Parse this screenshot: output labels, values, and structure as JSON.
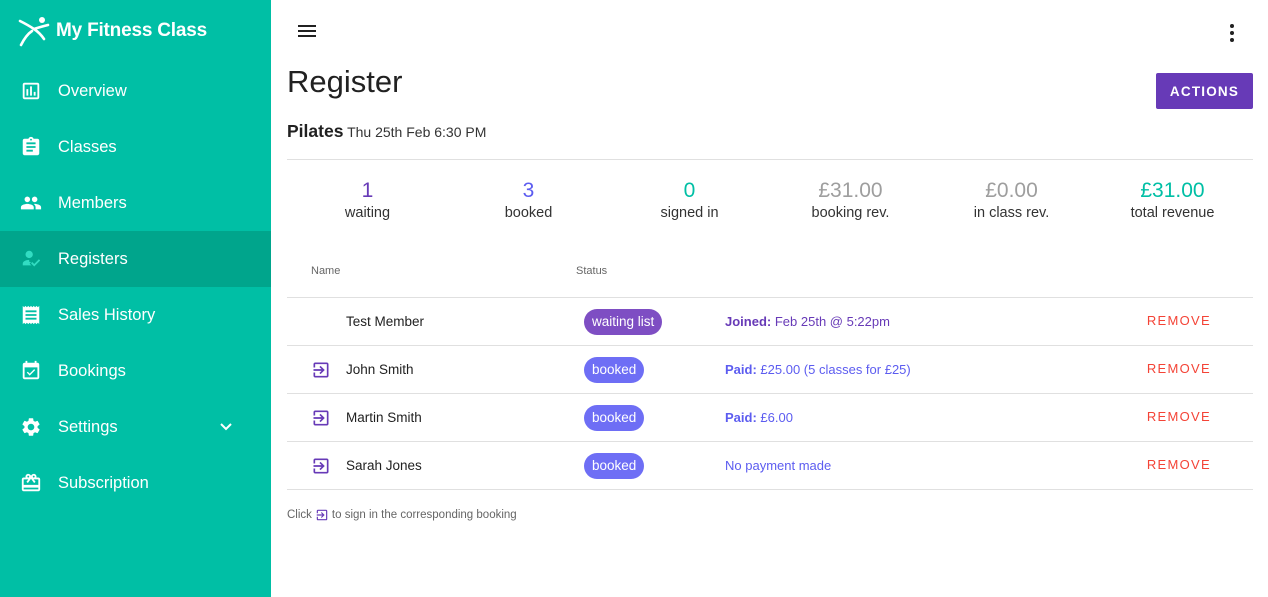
{
  "colors": {
    "sidebar_bg": "#00bfa5",
    "sidebar_active_bg": "#00a58c",
    "primary": "#673ab7",
    "booked": "#6e6ef5",
    "waiting": "#7e4ec3",
    "teal": "#00bfa5",
    "muted": "#9e9e9e",
    "danger": "#f44336"
  },
  "brand": {
    "name": "My Fitness Class",
    "logo_icon": "runner-logo-icon"
  },
  "sidebar": {
    "items": [
      {
        "label": "Overview",
        "icon": "bar-chart-icon",
        "active": false
      },
      {
        "label": "Classes",
        "icon": "clipboard-icon",
        "active": false
      },
      {
        "label": "Members",
        "icon": "people-icon",
        "active": false
      },
      {
        "label": "Registers",
        "icon": "person-check-icon",
        "active": true
      },
      {
        "label": "Sales History",
        "icon": "receipt-icon",
        "active": false
      },
      {
        "label": "Bookings",
        "icon": "calendar-check-icon",
        "active": false
      },
      {
        "label": "Settings",
        "icon": "gear-icon",
        "active": false,
        "expandable": true
      },
      {
        "label": "Subscription",
        "icon": "gift-card-icon",
        "active": false
      }
    ]
  },
  "header": {
    "menu_icon": "hamburger-menu-icon",
    "more_icon": "more-vertical-icon"
  },
  "page": {
    "title": "Register",
    "actions_label": "ACTIONS",
    "class_name": "Pilates",
    "class_when": "Thu 25th Feb 6:30 PM"
  },
  "stats": [
    {
      "value": "1",
      "label": "waiting",
      "color": "#673ab7"
    },
    {
      "value": "3",
      "label": "booked",
      "color": "#5c5cf0"
    },
    {
      "value": "0",
      "label": "signed in",
      "color": "#00bfa5"
    },
    {
      "value": "£31.00",
      "label": "booking rev.",
      "color": "#9e9e9e"
    },
    {
      "value": "£0.00",
      "label": "in class rev.",
      "color": "#9e9e9e"
    },
    {
      "value": "£31.00",
      "label": "total revenue",
      "color": "#00bfa5"
    }
  ],
  "table": {
    "headers": {
      "name": "Name",
      "status": "Status"
    },
    "rows": [
      {
        "name": "Test Member",
        "sign_in": false,
        "status": "waiting list",
        "status_color": "#7e4ec3",
        "detail_label": "Joined:",
        "detail_text": "Feb 25th @ 5:22pm",
        "detail_color": "#673ab7",
        "remove": "REMOVE"
      },
      {
        "name": "John Smith",
        "sign_in": true,
        "status": "booked",
        "status_color": "#6e6ef5",
        "detail_label": "Paid:",
        "detail_text": "£25.00  (5 classes for £25)",
        "detail_color": "#5c5cf0",
        "remove": "REMOVE"
      },
      {
        "name": "Martin Smith",
        "sign_in": true,
        "status": "booked",
        "status_color": "#6e6ef5",
        "detail_label": "Paid:",
        "detail_text": "£6.00",
        "detail_color": "#5c5cf0",
        "remove": "REMOVE"
      },
      {
        "name": "Sarah Jones",
        "sign_in": true,
        "status": "booked",
        "status_color": "#6e6ef5",
        "detail_label": "",
        "detail_text": "No payment made",
        "detail_color": "#5c5cf0",
        "remove": "REMOVE"
      }
    ]
  },
  "hint": {
    "before": "Click",
    "after": "to sign in the corresponding booking"
  }
}
